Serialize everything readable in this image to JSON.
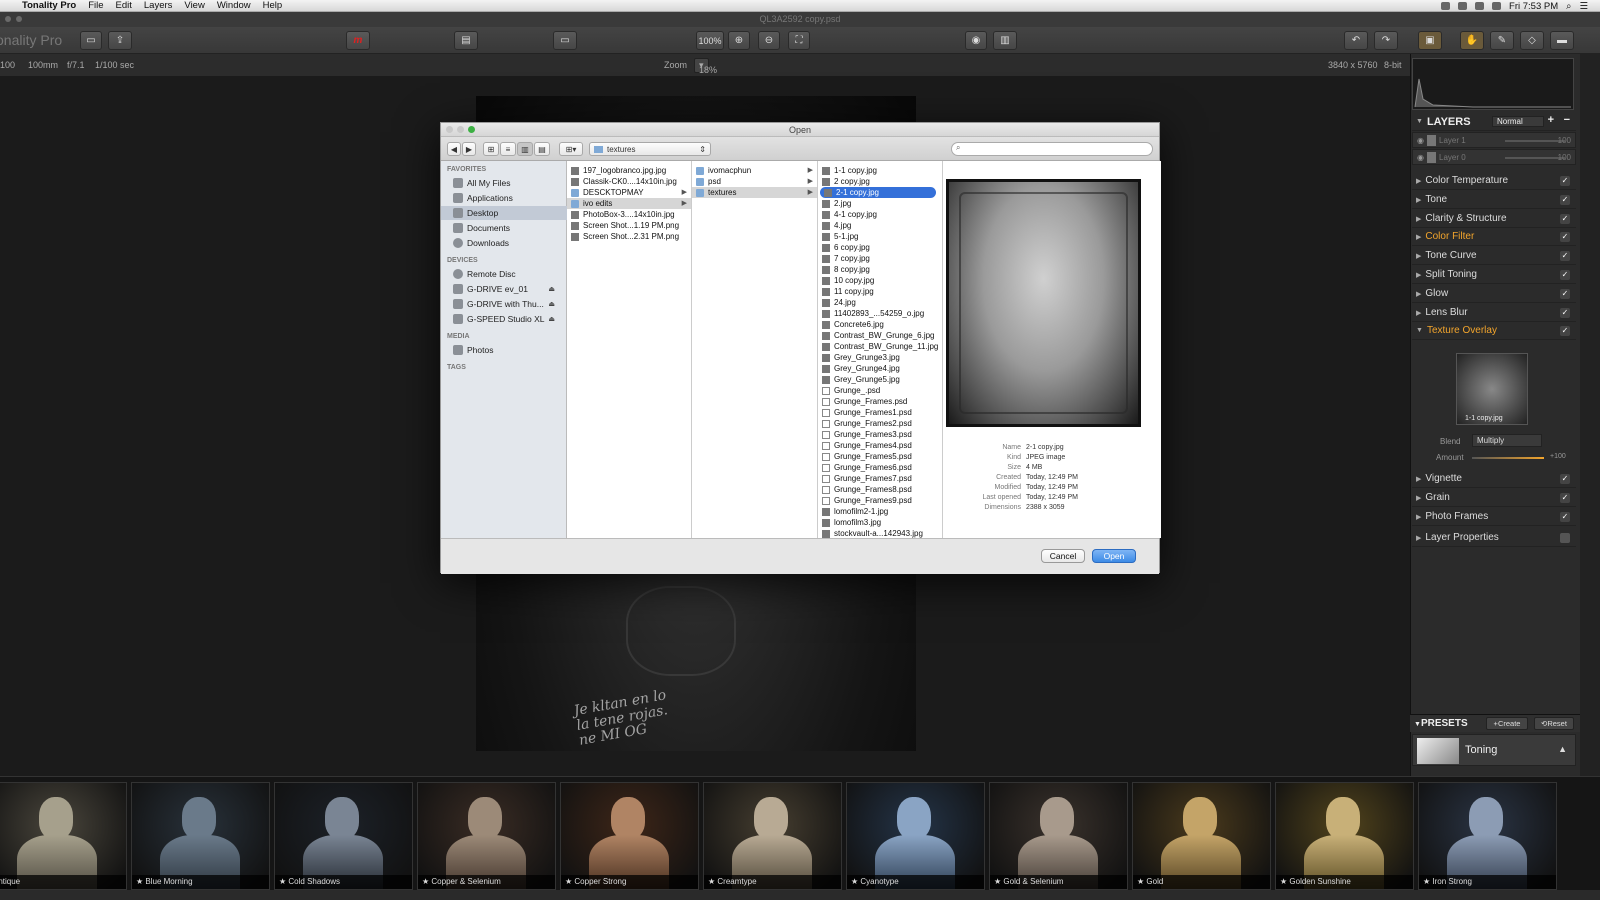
{
  "menubar": {
    "app_name": "Tonality Pro",
    "items": [
      "File",
      "Edit",
      "Layers",
      "View",
      "Window",
      "Help"
    ],
    "clock": "Fri 7:53 PM"
  },
  "window": {
    "title": "QL3A2592 copy.psd"
  },
  "toolbar": {
    "brand": "onality Pro",
    "zoom_percent": "100%"
  },
  "info_bar": {
    "iso": "100",
    "focal": "100mm",
    "aperture": "f/7.1",
    "shutter": "1/100 sec",
    "zoom_label": "Zoom",
    "zoom_value": "18%",
    "dimensions": "3840 x 5760",
    "bit_depth": "8-bit"
  },
  "photo_text": {
    "line1": "Je kltan en lo",
    "line2": "la tene rojas.",
    "line3": "ne MI OG"
  },
  "dialog": {
    "title": "Open",
    "location": "textures",
    "sidebar": {
      "favorites_header": "FAVORITES",
      "favorites": [
        "All My Files",
        "Applications",
        "Desktop",
        "Documents",
        "Downloads"
      ],
      "devices_header": "DEVICES",
      "devices": [
        "Remote Disc",
        "G-DRIVE ev_01",
        "G-DRIVE with Thu...",
        "G-SPEED Studio XL"
      ],
      "media_header": "MEDIA",
      "media": [
        "Photos"
      ],
      "tags_header": "TAGS"
    },
    "col1": [
      "197_logobranco.jpg.jpg",
      "Classik-CK0....14x10in.jpg",
      "DESCKTOPMAY",
      "ivo edits",
      "PhotoBox-3....14x10in.jpg",
      "Screen Shot...1.19 PM.png",
      "Screen Shot...2.31 PM.png"
    ],
    "col2": [
      "ivomacphun",
      "psd",
      "textures"
    ],
    "col3": [
      "1-1 copy.jpg",
      "2 copy.jpg",
      "2-1 copy.jpg",
      "2.jpg",
      "4-1 copy.jpg",
      "4.jpg",
      "5-1.jpg",
      "6 copy.jpg",
      "7 copy.jpg",
      "8 copy.jpg",
      "10 copy.jpg",
      "11 copy.jpg",
      "24.jpg",
      "11402893_...54259_o.jpg",
      "Concrete6.jpg",
      "Contrast_BW_Grunge_6.jpg",
      "Contrast_BW_Grunge_11.jpg",
      "Grey_Grunge3.jpg",
      "Grey_Grunge4.jpg",
      "Grey_Grunge5.jpg",
      "Grunge_.psd",
      "Grunge_Frames.psd",
      "Grunge_Frames1.psd",
      "Grunge_Frames2.psd",
      "Grunge_Frames3.psd",
      "Grunge_Frames4.psd",
      "Grunge_Frames5.psd",
      "Grunge_Frames6.psd",
      "Grunge_Frames7.psd",
      "Grunge_Frames8.psd",
      "Grunge_Frames9.psd",
      "lomofilm2-1.jpg",
      "lomofilm3.jpg",
      "stockvault-a...142943.jpg"
    ],
    "meta": {
      "name_k": "Name",
      "name_v": "2-1 copy.jpg",
      "kind_k": "Kind",
      "kind_v": "JPEG image",
      "size_k": "Size",
      "size_v": "4 MB",
      "created_k": "Created",
      "created_v": "Today, 12:49 PM",
      "modified_k": "Modified",
      "modified_v": "Today, 12:49 PM",
      "opened_k": "Last opened",
      "opened_v": "Today, 12:49 PM",
      "dims_k": "Dimensions",
      "dims_v": "2388 x 3059"
    },
    "cancel": "Cancel",
    "open": "Open"
  },
  "right_panel": {
    "layers_header": "LAYERS",
    "blend_mode": "Normal",
    "layers": [
      {
        "name": "Layer 1",
        "value": "100"
      },
      {
        "name": "Layer 0",
        "value": "100"
      }
    ],
    "sections": [
      "Color Temperature",
      "Tone",
      "Clarity & Structure",
      "Color Filter",
      "Tone Curve",
      "Split Toning",
      "Glow",
      "Lens Blur",
      "Texture Overlay"
    ],
    "texture": {
      "thumb_label": "1-1 copy.jpg",
      "blend_label": "Blend",
      "blend_value": "Multiply",
      "amount_label": "Amount",
      "amount_value": "+100"
    },
    "sections2": [
      "Vignette",
      "Grain",
      "Photo Frames",
      "Layer Properties"
    ],
    "presets_header": "PRESETS",
    "create": "Create",
    "reset": "Reset",
    "preset_name": "Toning"
  },
  "filmstrip": [
    "Antique",
    "Blue Morning",
    "Cold Shadows",
    "Copper & Selenium",
    "Copper Strong",
    "Creamtype",
    "Cyanotype",
    "Gold & Selenium",
    "Gold",
    "Golden Sunshine",
    "Iron Strong"
  ],
  "colors": {
    "accent_orange": "#f3a52c",
    "selection_blue": "#3470d9"
  }
}
